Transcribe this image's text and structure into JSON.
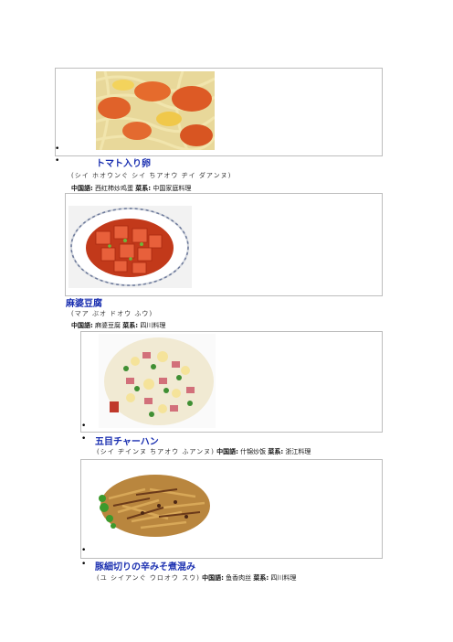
{
  "dishes": [
    {
      "title": "トマト入り卵",
      "reading": "(シイ ホオウンぐ シイ ちアオウ ヂイ ダアンヌ)",
      "chinese_label": "中国語:",
      "chinese_name": "西红柿炒鸡蛋",
      "category_label": "菜系:",
      "category": "中国家庭料理",
      "image": "tomato-egg-noodles-photo"
    },
    {
      "title": "麻婆豆腐",
      "reading": "(マア ぶオ ドオウ ふウ)",
      "chinese_label": "中国語:",
      "chinese_name": "麻婆豆腐",
      "category_label": "菜系:",
      "category": "四川料理",
      "image": "mapo-tofu-photo"
    },
    {
      "title": "五目チャーハン",
      "reading": "(シイ ヂインヌ ちアオウ ふアンヌ)",
      "chinese_label": "中国語:",
      "chinese_name": "什锦炒饭",
      "category_label": "菜系:",
      "category": "浙江料理",
      "image": "fried-rice-photo"
    },
    {
      "title": "豚細切りの辛みそ煮混み",
      "reading": "(ユ シイアンぐ ウロオウ スウ)",
      "chinese_label": "中国語:",
      "chinese_name": "鱼香肉丝",
      "category_label": "菜系:",
      "category": "四川料理",
      "image": "yuxiang-pork-photo"
    }
  ],
  "bullet_glyph": "•",
  "colors": {
    "title": "#1a2fb0",
    "border": "#bdbdbd"
  }
}
